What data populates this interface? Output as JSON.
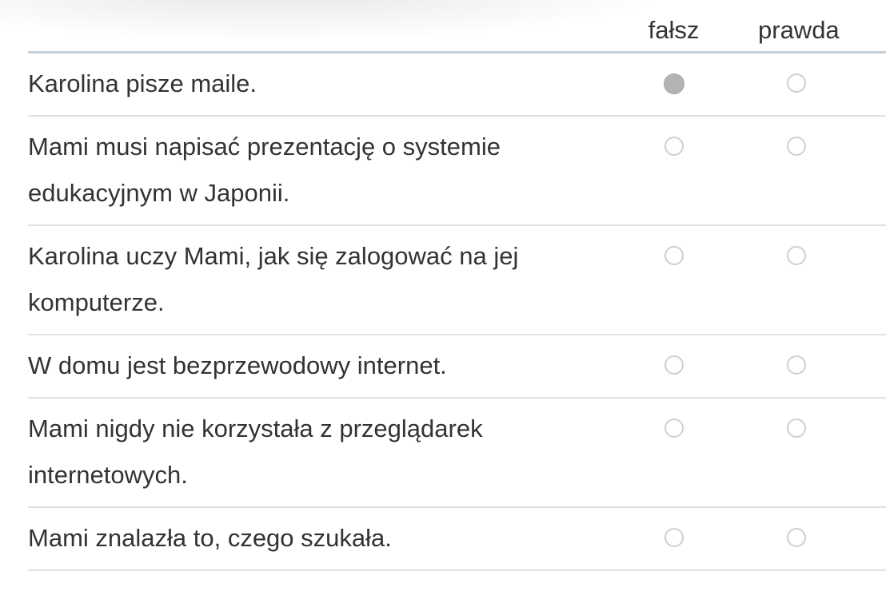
{
  "header": {
    "false_label": "fałsz",
    "true_label": "prawda"
  },
  "statements": [
    {
      "text": "Karolina pisze maile.",
      "selected": "false"
    },
    {
      "text": "Mami musi napisać prezentację o systemie edukacyjnym w Japonii.",
      "selected": null
    },
    {
      "text": "Karolina uczy Mami, jak się zalogować na jej komputerze.",
      "selected": null
    },
    {
      "text": "W domu jest bezprzewodowy internet.",
      "selected": null
    },
    {
      "text": "Mami nigdy nie korzystała z przeglądarek internetowych.",
      "selected": null
    },
    {
      "text": "Mami znalazła to, czego szukała.",
      "selected": null
    }
  ],
  "colors": {
    "text": "#333333",
    "header_rule": "#c5cfd9",
    "row_rule": "#dde2e6",
    "radio_border": "#cfcfcf",
    "radio_selected_fill": "#b3b3b3"
  }
}
